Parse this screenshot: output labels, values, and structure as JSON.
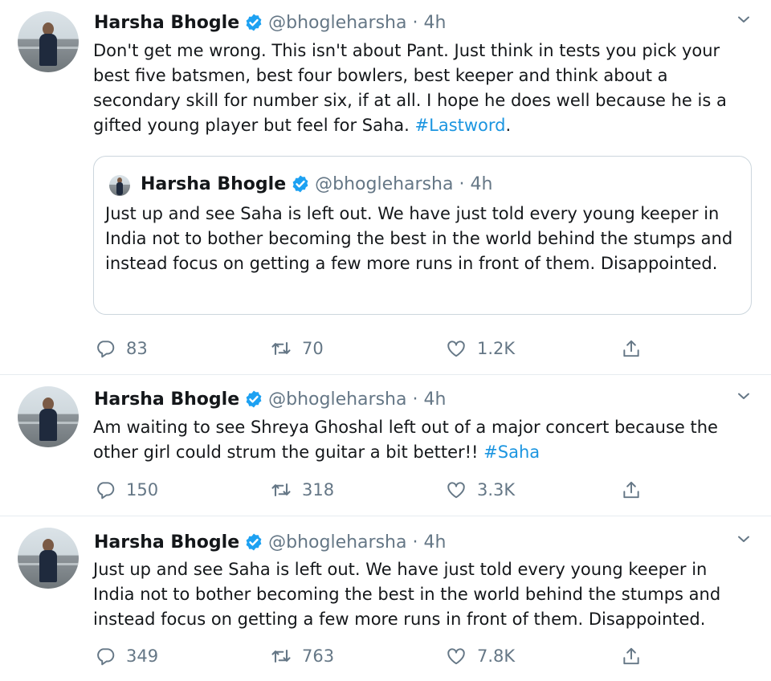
{
  "colors": {
    "text": "#14171a",
    "muted": "#657786",
    "link": "#1b95e0",
    "verified": "#1da1f2",
    "border": "#e6ecf0"
  },
  "tweets": [
    {
      "author": {
        "name": "Harsha Bhogle",
        "handle": "@bhogleharsha",
        "separator": "·",
        "time": "4h",
        "verified": true
      },
      "text": "Don't get me wrong. This isn't about Pant. Just think in tests you pick your best five batsmen, best four bowlers, best keeper and think about a secondary skill for number six, if at all. I hope he does well because he is a gifted young player but feel for Saha.",
      "hashtag": "#Lastword",
      "trailing": ".",
      "quoted": {
        "name": "Harsha Bhogle",
        "handle": "@bhogleharsha",
        "separator": "·",
        "time": "4h",
        "text": "Just up and see Saha is left out. We have just told every young keeper in India not to bother becoming the best in the world behind the stumps and instead focus on getting a few more runs in front of them. Disappointed."
      },
      "replies": "83",
      "retweets": "70",
      "likes": "1.2K"
    },
    {
      "author": {
        "name": "Harsha Bhogle",
        "handle": "@bhogleharsha",
        "separator": "·",
        "time": "4h",
        "verified": true
      },
      "text": "Am waiting to see Shreya Ghoshal left out of a major concert because the other girl could strum the guitar a bit better!!",
      "hashtag": "#Saha",
      "trailing": "",
      "replies": "150",
      "retweets": "318",
      "likes": "3.3K"
    },
    {
      "author": {
        "name": "Harsha Bhogle",
        "handle": "@bhogleharsha",
        "separator": "·",
        "time": "4h",
        "verified": true
      },
      "text": "Just up and see Saha is left out. We have just told every young keeper in India not to bother becoming the best in the world behind the stumps and instead focus on getting a few more runs in front of them. Disappointed.",
      "replies": "349",
      "retweets": "763",
      "likes": "7.8K"
    }
  ],
  "icons": {
    "reply": "reply-icon",
    "retweet": "retweet-icon",
    "like": "like-icon",
    "share": "share-icon",
    "more": "chevron-down-icon",
    "verified": "verified-badge-icon"
  }
}
